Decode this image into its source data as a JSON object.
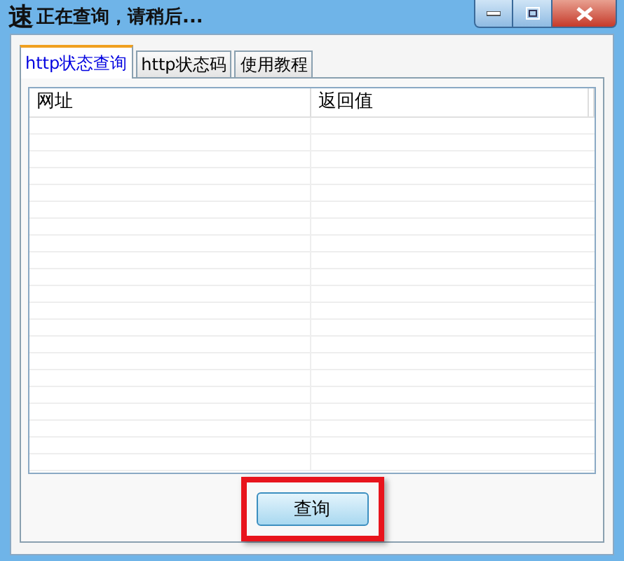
{
  "window": {
    "icon": "速",
    "title": "正在查询，请稍后..."
  },
  "tabs": [
    {
      "label": "http状态查询",
      "selected": true
    },
    {
      "label": "http状态码",
      "selected": false
    },
    {
      "label": "使用教程",
      "selected": false
    }
  ],
  "table": {
    "columns": [
      "网址",
      "返回值"
    ]
  },
  "buttons": [
    {
      "label": "查询",
      "highlighted": true
    }
  ]
}
